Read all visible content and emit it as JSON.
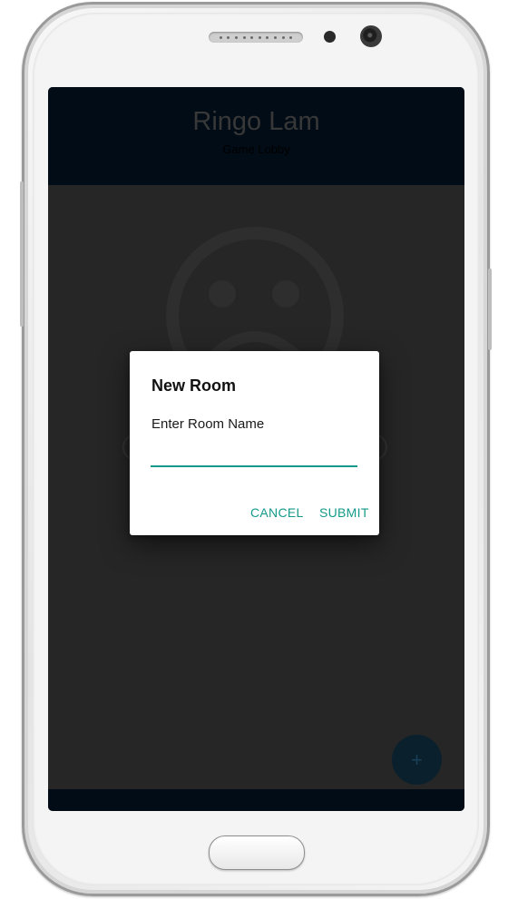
{
  "app": {
    "title": "Ringo Lam",
    "subtitle": "Game Lobby",
    "fab_label": "+"
  },
  "empty_state": {
    "icon": "sad-face-icon"
  },
  "dialog": {
    "title": "New Room",
    "message": "Enter Room Name",
    "input_value": "",
    "cancel_label": "CANCEL",
    "submit_label": "SUBMIT"
  },
  "colors": {
    "accent": "#149a8a",
    "header": "#020e18",
    "background": "#2a2a2a",
    "fab": "#0c2331"
  }
}
